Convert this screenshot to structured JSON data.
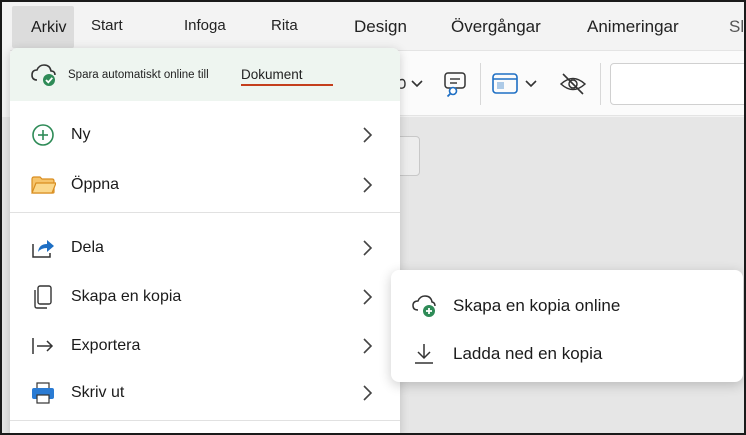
{
  "ribbon": {
    "tabs": [
      "Arkiv",
      "Start",
      "Infoga",
      "Rita",
      "Design",
      "Övergångar",
      "Animeringar",
      "Sl"
    ]
  },
  "save_bar": {
    "text": "Spara automatiskt online till",
    "location": "Dokument"
  },
  "menu": {
    "items": [
      {
        "label": "Ny",
        "icon": "plus-circle-icon"
      },
      {
        "label": "Öppna",
        "icon": "folder-icon"
      },
      {
        "label": "Dela",
        "icon": "share-icon"
      },
      {
        "label": "Skapa en kopia",
        "icon": "copy-icon"
      },
      {
        "label": "Exportera",
        "icon": "export-arrow-icon"
      },
      {
        "label": "Skriv ut",
        "icon": "printer-icon"
      }
    ]
  },
  "submenu": {
    "items": [
      {
        "label": "Skapa en kopia online",
        "icon": "cloud-add-icon"
      },
      {
        "label": "Ladda ned en kopia",
        "icon": "download-icon"
      }
    ]
  },
  "colors": {
    "accent_green": "#2e8b57",
    "folder_orange": "#e8a33b",
    "share_blue": "#1e6fc4",
    "link_underline": "#c43e1c"
  }
}
